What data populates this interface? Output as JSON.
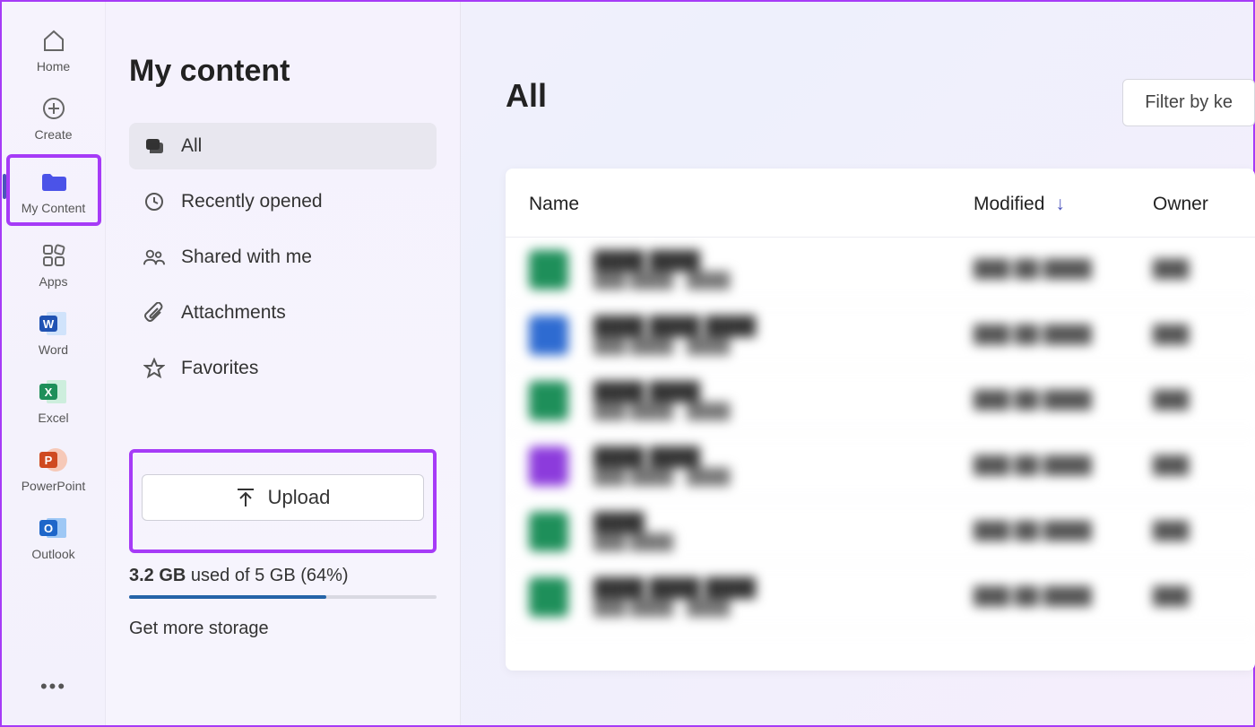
{
  "rail": {
    "items": [
      {
        "label": "Home"
      },
      {
        "label": "Create"
      },
      {
        "label": "My Content"
      },
      {
        "label": "Apps"
      },
      {
        "label": "Word"
      },
      {
        "label": "Excel"
      },
      {
        "label": "PowerPoint"
      },
      {
        "label": "Outlook"
      }
    ]
  },
  "panel": {
    "title": "My content",
    "nav": [
      {
        "label": "All"
      },
      {
        "label": "Recently opened"
      },
      {
        "label": "Shared with me"
      },
      {
        "label": "Attachments"
      },
      {
        "label": "Favorites"
      }
    ],
    "upload_label": "Upload",
    "storage_used": "3.2 GB",
    "storage_text_rest": " used of 5 GB (64%)",
    "storage_pct": 64,
    "get_more": "Get more storage"
  },
  "main": {
    "heading": "All",
    "filter_label": "Filter by ke",
    "columns": {
      "name": "Name",
      "modified": "Modified",
      "owner": "Owner"
    }
  }
}
